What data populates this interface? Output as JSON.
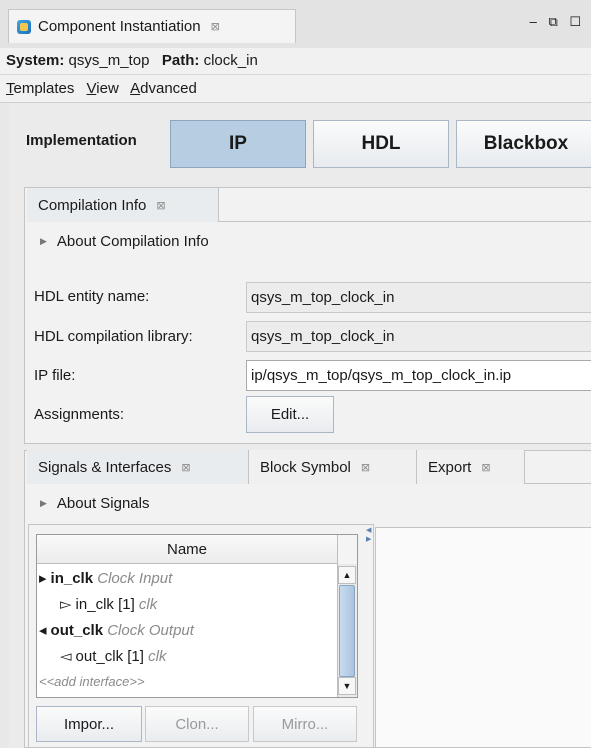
{
  "window_tab": {
    "title": "Component Instantiation",
    "close": "⊠",
    "controls": "‒ ⧉ ☐"
  },
  "system_line": {
    "system_label": "System:",
    "system_value": "qsys_m_top",
    "path_label": "Path:",
    "path_value": "clock_in"
  },
  "menu": [
    {
      "mnemonic": "T",
      "rest": "emplates"
    },
    {
      "mnemonic": "V",
      "rest": "iew"
    },
    {
      "mnemonic": "A",
      "rest": "dvanced"
    }
  ],
  "implementation": {
    "label": "Implementation",
    "options": [
      "IP",
      "HDL",
      "Blackbox"
    ],
    "selected": "IP"
  },
  "compilation": {
    "tab_label": "Compilation Info",
    "about": "About Compilation Info",
    "fields": [
      {
        "label": "HDL entity name:",
        "value": "qsys_m_top_clock_in"
      },
      {
        "label": "HDL compilation library:",
        "value": "qsys_m_top_clock_in"
      },
      {
        "label": "IP file:",
        "value": "ip/qsys_m_top/qsys_m_top_clock_in.ip"
      }
    ],
    "assignments_label": "Assignments:",
    "edit_button": "Edit..."
  },
  "signals": {
    "tabs": [
      "Signals & Interfaces",
      "Block Symbol",
      "Export"
    ],
    "about": "About Signals",
    "column_header": "Name",
    "rows": [
      {
        "name": "in_clk",
        "type": "Clock Input",
        "glyph": "▸"
      },
      {
        "name": "in_clk [1]",
        "type": "clk",
        "glyph": "▻"
      },
      {
        "name": "out_clk",
        "type": "Clock Output",
        "glyph": "◂"
      },
      {
        "name": "out_clk [1]",
        "type": "clk",
        "glyph": "◅"
      }
    ],
    "add_interface": "<<add interface>>",
    "buttons": {
      "import": "Impor...",
      "clone": "Clon...",
      "mirror": "Mirro..."
    }
  }
}
